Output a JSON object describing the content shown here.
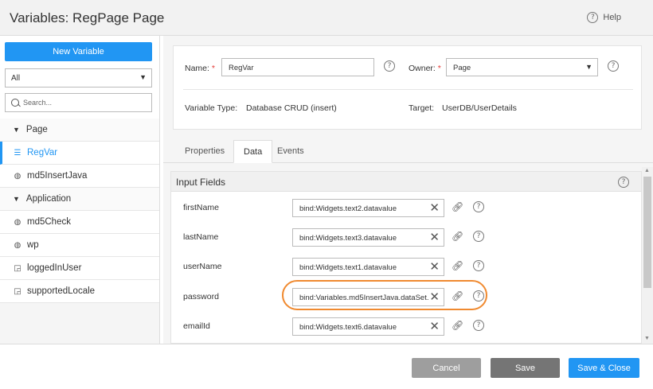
{
  "header": {
    "title": "Variables: RegPage Page",
    "help_label": "Help",
    "help_icon": "question-icon"
  },
  "sidebar": {
    "new_variable_label": "New Variable",
    "filter_value": "All",
    "search_placeholder": "Search...",
    "items": [
      {
        "label": "Page",
        "type": "group",
        "icon": "triangle-down-icon"
      },
      {
        "label": "RegVar",
        "type": "item",
        "icon": "database-icon",
        "active": true
      },
      {
        "label": "md5InsertJava",
        "type": "item",
        "icon": "globe-icon"
      },
      {
        "label": "Application",
        "type": "group",
        "icon": "triangle-down-icon"
      },
      {
        "label": "md5Check",
        "type": "item",
        "icon": "globe-icon"
      },
      {
        "label": "wp",
        "type": "item",
        "icon": "globe-icon"
      },
      {
        "label": "loggedInUser",
        "type": "item",
        "icon": "model-icon"
      },
      {
        "label": "supportedLocale",
        "type": "item",
        "icon": "model-icon"
      }
    ]
  },
  "properties": {
    "name_label": "Name:",
    "name_value": "RegVar",
    "owner_label": "Owner:",
    "owner_value": "Page",
    "variable_type_label": "Variable Type:",
    "variable_type_value": "Database CRUD (insert)",
    "target_label": "Target:",
    "target_value": "UserDB/UserDetails"
  },
  "tabs": [
    {
      "label": "Properties",
      "active": false
    },
    {
      "label": "Data",
      "active": true
    },
    {
      "label": "Events",
      "active": false
    }
  ],
  "input_fields": {
    "title": "Input Fields",
    "rows": [
      {
        "label": "firstName",
        "value": "bind:Widgets.text2.datavalue"
      },
      {
        "label": "lastName",
        "value": "bind:Widgets.text3.datavalue"
      },
      {
        "label": "userName",
        "value": "bind:Widgets.text1.datavalue"
      },
      {
        "label": "password",
        "value": "bind:Variables.md5InsertJava.dataSet.",
        "highlighted": true
      },
      {
        "label": "emailId",
        "value": "bind:Widgets.text6.datavalue"
      }
    ]
  },
  "footer": {
    "cancel_label": "Cancel",
    "save_label": "Save",
    "save_close_label": "Save & Close"
  },
  "colors": {
    "accent": "#2196f3",
    "highlight": "#f08a30",
    "cancel_bg": "#9e9e9e",
    "save_bg": "#757575"
  }
}
